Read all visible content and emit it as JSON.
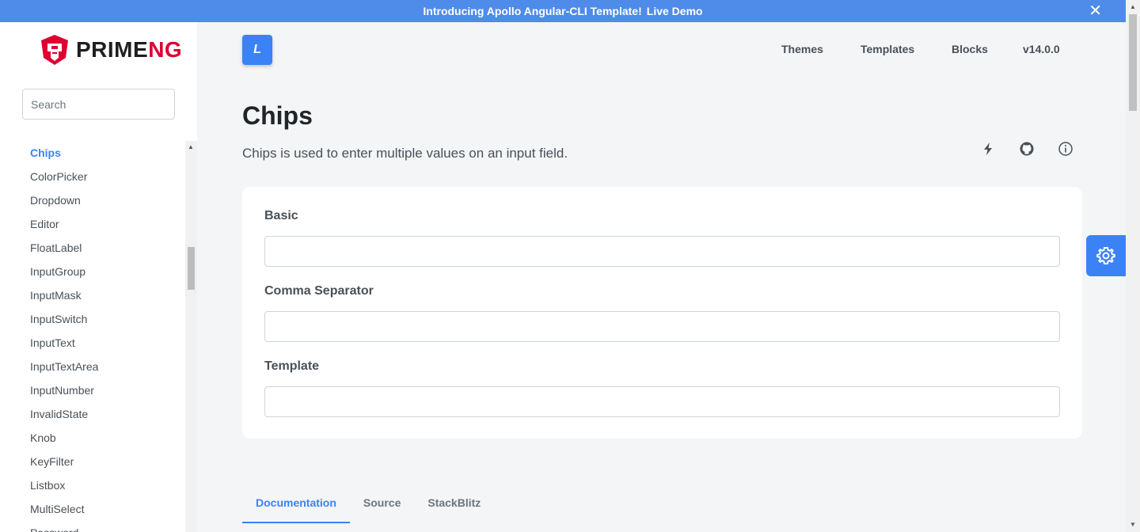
{
  "announcement": {
    "text": "Introducing Apollo Angular-CLI Template!",
    "link": "Live Demo",
    "close": "✕"
  },
  "brand": {
    "prefix": "PRIME",
    "suffix": "NG"
  },
  "search": {
    "placeholder": "Search",
    "value": ""
  },
  "menu": {
    "items": [
      "Chips",
      "ColorPicker",
      "Dropdown",
      "Editor",
      "FloatLabel",
      "InputGroup",
      "InputMask",
      "InputSwitch",
      "InputText",
      "InputTextArea",
      "InputNumber",
      "InvalidState",
      "Knob",
      "KeyFilter",
      "Listbox",
      "MultiSelect",
      "Password"
    ],
    "active": "Chips"
  },
  "header": {
    "layout_logo": "L",
    "nav": [
      "Themes",
      "Templates",
      "Blocks",
      "v14.0.0"
    ]
  },
  "page": {
    "title": "Chips",
    "description": "Chips is used to enter multiple values on an input field.",
    "icons": [
      "bolt-icon",
      "github-icon",
      "info-icon"
    ]
  },
  "demo": {
    "sections": [
      {
        "label": "Basic"
      },
      {
        "label": "Comma Separator"
      },
      {
        "label": "Template"
      }
    ]
  },
  "tabs": {
    "items": [
      "Documentation",
      "Source",
      "StackBlitz"
    ],
    "active": "Documentation"
  },
  "colors": {
    "primary": "#3b82f6",
    "announcement_bg": "#4f8be8",
    "brand_red": "#dd0031"
  }
}
